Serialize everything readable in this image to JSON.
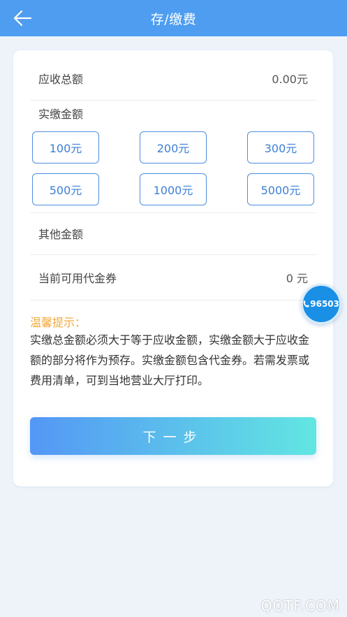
{
  "header": {
    "title": "存/缴费",
    "back_icon": "arrow-left-icon"
  },
  "receivable": {
    "label": "应收总额",
    "value": "0.00元"
  },
  "paid": {
    "label": "实缴金额",
    "options": [
      "100元",
      "200元",
      "300元",
      "500元",
      "1000元",
      "5000元"
    ]
  },
  "other": {
    "label": "其他金额"
  },
  "voucher": {
    "label": "当前可用代金券",
    "value": "0 元"
  },
  "tip": {
    "title": "温馨提示：",
    "text": "实缴总金额必须大于等于应收金额，实缴金额大于应收金额的部分将作为预存。实缴金额包含代金券。若需发票或费用清单，可到当地营业大厅打印。"
  },
  "next_button": {
    "label": "下一步"
  },
  "hotline": {
    "number": "96503",
    "icon": "phone-icon"
  },
  "watermark": "QQTF.COM",
  "colors": {
    "header": "#4e9df0",
    "accent_text": "#3c7fd6",
    "tip": "#f2a93b",
    "button_gradient_start": "#5497f5",
    "button_gradient_end": "#62e6e2",
    "hotline": "#1a8fe6"
  }
}
